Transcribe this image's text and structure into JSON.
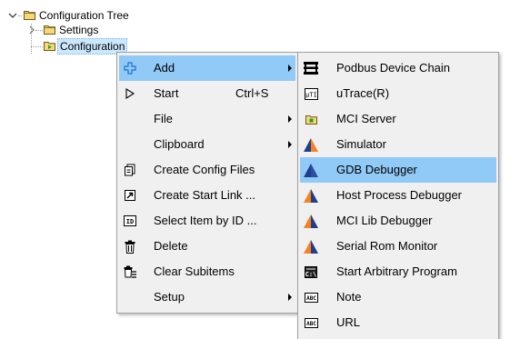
{
  "tree": {
    "root_label": "Configuration Tree",
    "settings_label": "Settings",
    "configuration_label": "Configuration"
  },
  "context_menu": {
    "items": [
      {
        "label": "Add",
        "icon": "plus-icon",
        "submenu": true,
        "highlighted": true
      },
      {
        "label": "Start",
        "shortcut": "Ctrl+S",
        "icon": "play-outline-icon"
      },
      {
        "label": "File",
        "submenu": true
      },
      {
        "label": "Clipboard",
        "submenu": true
      },
      {
        "label": "Create Config Files",
        "icon": "config-files-icon"
      },
      {
        "label": "Create Start Link ...",
        "icon": "shortcut-link-icon"
      },
      {
        "label": "Select Item by ID ...",
        "icon": "id-icon"
      },
      {
        "label": "Delete",
        "icon": "trash-icon"
      },
      {
        "label": "Clear Subitems",
        "icon": "clear-subitems-icon"
      },
      {
        "label": "Setup",
        "submenu": true
      }
    ]
  },
  "add_submenu": {
    "items": [
      {
        "label": "Podbus Device Chain",
        "icon": "device-chain-icon"
      },
      {
        "label": "uTrace(R)",
        "icon": "utrace-icon"
      },
      {
        "label": "MCI Server",
        "icon": "mci-server-folder-icon"
      },
      {
        "label": "Simulator",
        "icon": "simulator-icon"
      },
      {
        "label": "GDB Debugger",
        "icon": "debugger-icon",
        "highlighted": true
      },
      {
        "label": "Host Process Debugger",
        "icon": "debugger-icon"
      },
      {
        "label": "MCI Lib Debugger",
        "icon": "debugger-icon"
      },
      {
        "label": "Serial Rom Monitor",
        "icon": "debugger-icon"
      },
      {
        "label": "Start Arbitrary Program",
        "icon": "program-icon"
      },
      {
        "label": "Note",
        "icon": "note-icon"
      },
      {
        "label": "URL",
        "icon": "url-icon"
      }
    ]
  },
  "colors": {
    "menu_background": "#f0f0f0",
    "menu_highlight": "#91c9f7",
    "folder_yellow": "#f8d775",
    "debugger_orange": "#f58220",
    "debugger_blue": "#1f3e8c"
  }
}
